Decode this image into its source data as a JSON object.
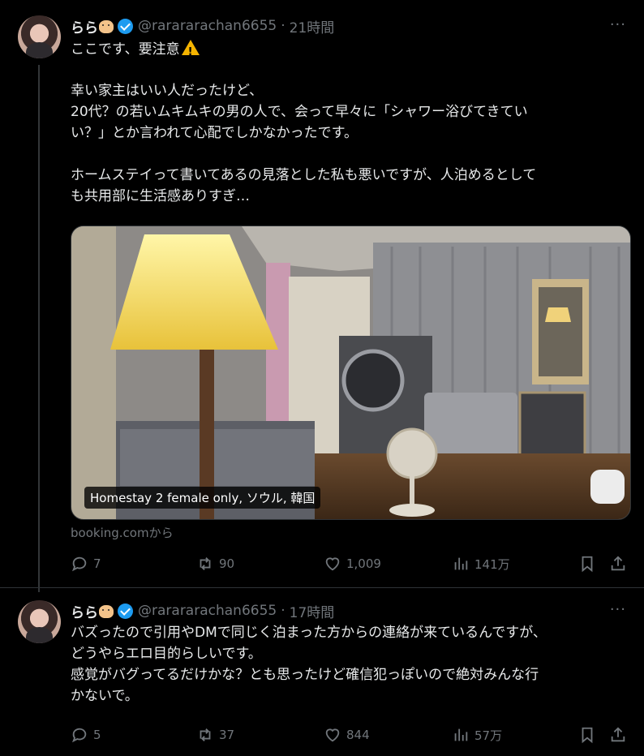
{
  "tweets": [
    {
      "name": "らら",
      "handle": "@rarararachan6655",
      "dot": "·",
      "time": "21時間",
      "text_line1": "ここです、要注意",
      "text_rest": "幸い家主はいい人だったけど、\n20代？の若いムキムキの男の人で、会って早々に「シャワー浴びてきてい\nい？」とか言われて心配でしかなかったです。\n\nホームステイって書いてあるの見落とした私も悪いですが、人泊めるとして\nも共用部に生活感ありすぎ…",
      "media_label": "Homestay 2 female only, ソウル, 韓国",
      "source": "booking.comから",
      "replies": "7",
      "retweets": "90",
      "likes": "1,009",
      "views": "141万"
    },
    {
      "name": "らら",
      "handle": "@rarararachan6655",
      "dot": "·",
      "time": "17時間",
      "text": "バズったので引用やDMで同じく泊まった方からの連絡が来ているんですが、\nどうやらエロ目的らしいです。\n感覚がバグってるだけかな？とも思ったけど確信犯っぽいので絶対みんな行\nかないで。",
      "replies": "5",
      "retweets": "37",
      "likes": "844",
      "views": "57万"
    }
  ],
  "more_icon": "···",
  "colors": {
    "text": "#e7e9ea",
    "muted": "#71767b",
    "verified": "#1d9bf0",
    "background": "#000000"
  }
}
